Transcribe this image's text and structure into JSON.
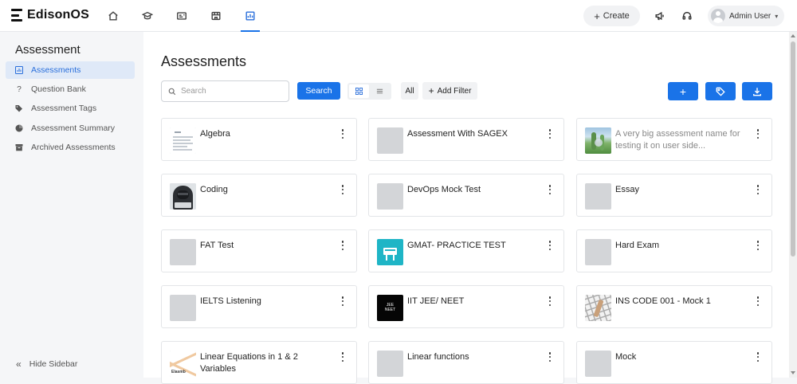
{
  "app": {
    "name": "EdisonOS"
  },
  "topnav": {
    "icons": [
      "home-icon",
      "graduation-cap-icon",
      "id-card-icon",
      "storefront-icon",
      "assessment-icon"
    ],
    "active_index": 4,
    "create_label": "Create",
    "user_name": "Admin User"
  },
  "sidebar": {
    "title": "Assessment",
    "items": [
      {
        "label": "Assessments",
        "icon": "assessment-icon"
      },
      {
        "label": "Question Bank",
        "icon": "question-icon"
      },
      {
        "label": "Assessment Tags",
        "icon": "tag-icon"
      },
      {
        "label": "Assessment Summary",
        "icon": "chart-icon"
      },
      {
        "label": "Archived Assessments",
        "icon": "archive-icon"
      }
    ],
    "hide_label": "Hide Sidebar"
  },
  "main": {
    "title": "Assessments",
    "search_placeholder": "Search",
    "search_button": "Search",
    "filter_all": "All",
    "add_filter": "Add Filter",
    "cards": [
      {
        "title": "Algebra",
        "thumb": "document"
      },
      {
        "title": "Assessment With SAGEX",
        "thumb": "placeholder"
      },
      {
        "title": "A very big assessment name for testing it on user side...",
        "thumb": "nature"
      },
      {
        "title": "Coding",
        "thumb": "hacker"
      },
      {
        "title": "DevOps Mock Test",
        "thumb": "placeholder"
      },
      {
        "title": "Essay",
        "thumb": "placeholder"
      },
      {
        "title": "FAT Test",
        "thumb": "placeholder"
      },
      {
        "title": "GMAT- PRACTICE TEST",
        "thumb": "gmat"
      },
      {
        "title": "Hard Exam",
        "thumb": "placeholder"
      },
      {
        "title": "IELTS Listening",
        "thumb": "placeholder"
      },
      {
        "title": "IIT JEE/ NEET",
        "thumb": "jee"
      },
      {
        "title": "INS CODE 001 - Mock 1",
        "thumb": "grid"
      },
      {
        "title": "Linear Equations in 1 & 2 Variables",
        "thumb": "linear"
      },
      {
        "title": "Linear functions",
        "thumb": "placeholder"
      },
      {
        "title": "Mock",
        "thumb": "placeholder"
      }
    ],
    "jee_thumb_text": "JEE\nNEET",
    "linear_thumb_text": "Elasmb"
  },
  "colors": {
    "accent": "#1a73e8",
    "active_bg": "#dfe9f8",
    "card_border": "#e3e5e8"
  }
}
